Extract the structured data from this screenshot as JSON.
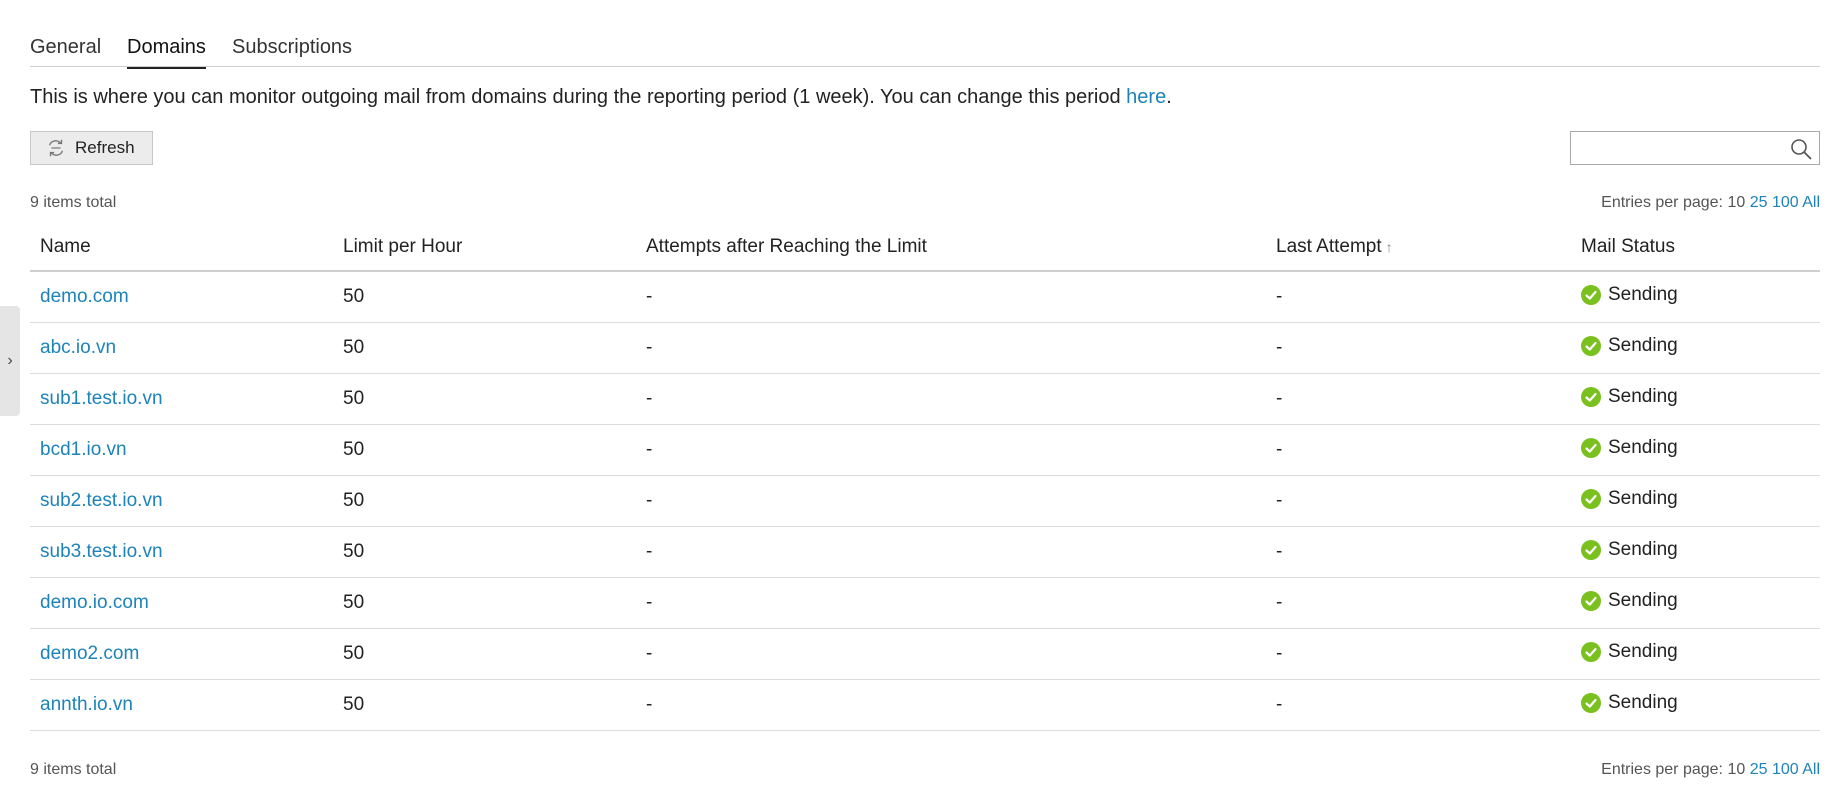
{
  "tabs": [
    {
      "label": "General"
    },
    {
      "label": "Domains"
    },
    {
      "label": "Subscriptions"
    }
  ],
  "intro": {
    "text": "This is where you can monitor outgoing mail from domains during the reporting period (1 week). You can change this period ",
    "link": "here",
    "suffix": "."
  },
  "toolbar": {
    "refresh_label": "Refresh",
    "search_placeholder": ""
  },
  "summary": {
    "total": "9 items total",
    "entries_label": "Entries per page:",
    "entries_options": [
      "10",
      "25",
      "100",
      "All"
    ]
  },
  "table": {
    "columns": [
      "Name",
      "Limit per Hour",
      "Attempts after Reaching the Limit",
      "Last Attempt",
      "Mail Status"
    ],
    "sort_indicator": "↑",
    "rows": [
      {
        "name": "demo.com",
        "limit": "50",
        "attempts": "-",
        "last": "-",
        "status": "Sending"
      },
      {
        "name": "abc.io.vn",
        "limit": "50",
        "attempts": "-",
        "last": "-",
        "status": "Sending"
      },
      {
        "name": "sub1.test.io.vn",
        "limit": "50",
        "attempts": "-",
        "last": "-",
        "status": "Sending"
      },
      {
        "name": "bcd1.io.vn",
        "limit": "50",
        "attempts": "-",
        "last": "-",
        "status": "Sending"
      },
      {
        "name": "sub2.test.io.vn",
        "limit": "50",
        "attempts": "-",
        "last": "-",
        "status": "Sending"
      },
      {
        "name": "sub3.test.io.vn",
        "limit": "50",
        "attempts": "-",
        "last": "-",
        "status": "Sending"
      },
      {
        "name": "demo.io.com",
        "limit": "50",
        "attempts": "-",
        "last": "-",
        "status": "Sending"
      },
      {
        "name": "demo2.com",
        "limit": "50",
        "attempts": "-",
        "last": "-",
        "status": "Sending"
      },
      {
        "name": "annth.io.vn",
        "limit": "50",
        "attempts": "-",
        "last": "-",
        "status": "Sending"
      }
    ]
  },
  "side_toggle": "›",
  "colors": {
    "link": "#1d83b9",
    "status_ok": "#7ac01e"
  },
  "icons": [
    "refresh-icon",
    "search-icon",
    "check-circle-icon",
    "chevron-right-icon"
  ]
}
